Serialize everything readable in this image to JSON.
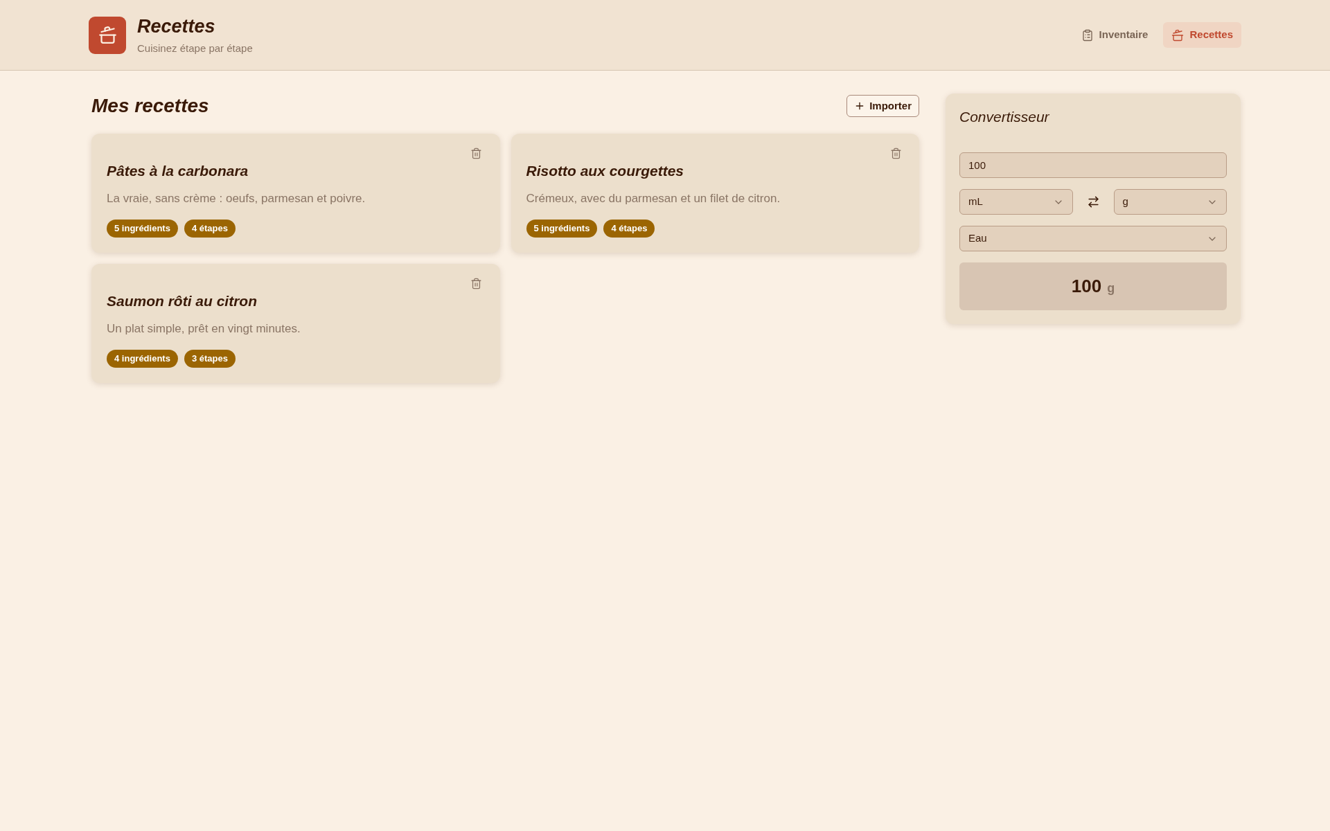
{
  "header": {
    "title": "Recettes",
    "subtitle": "Cuisinez étape par étape",
    "nav": [
      {
        "label": "Inventaire",
        "kind": "clipboard",
        "selected": false
      },
      {
        "label": "Recettes",
        "kind": "pot",
        "selected": true
      }
    ]
  },
  "recipes": {
    "title": "Mes recettes",
    "import_button": "Importer",
    "cards": [
      {
        "title": "Pâtes à la carbonara",
        "description": "La vraie, sans crème : oeufs, parmesan et poivre.",
        "badges": [
          "5 ingrédients",
          "4 étapes"
        ]
      },
      {
        "title": "Risotto aux courgettes",
        "description": "Crémeux, avec du parmesan et un filet de citron.",
        "badges": [
          "5 ingrédients",
          "4 étapes"
        ]
      },
      {
        "title": "Saumon rôti au citron",
        "description": "Un plat simple, prêt en vingt minutes.",
        "badges": [
          "4 ingrédients",
          "3 étapes"
        ]
      }
    ]
  },
  "converter": {
    "title": "Convertisseur",
    "amount": "100",
    "from_unit": "mL",
    "to_unit": "g",
    "ingredient": "Eau",
    "result": {
      "value": "100",
      "unit": "g"
    }
  }
}
